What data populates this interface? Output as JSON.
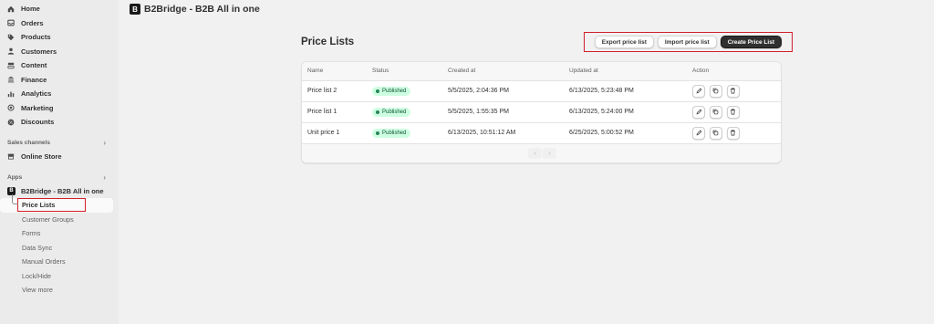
{
  "app": {
    "title": "B2Bridge - B2B All in one",
    "logo_letter": "B"
  },
  "sidebar": {
    "nav": [
      {
        "label": "Home",
        "icon": "home-icon"
      },
      {
        "label": "Orders",
        "icon": "orders-icon"
      },
      {
        "label": "Products",
        "icon": "tag-icon"
      },
      {
        "label": "Customers",
        "icon": "person-icon"
      },
      {
        "label": "Content",
        "icon": "content-icon"
      },
      {
        "label": "Finance",
        "icon": "bank-icon"
      },
      {
        "label": "Analytics",
        "icon": "bar-chart-icon"
      },
      {
        "label": "Marketing",
        "icon": "target-icon"
      },
      {
        "label": "Discounts",
        "icon": "discount-icon"
      }
    ],
    "sales_channels_label": "Sales channels",
    "online_store_label": "Online Store",
    "apps_label": "Apps",
    "app_name": "B2Bridge - B2B All in one",
    "app_subitems": [
      "Price Lists",
      "Customer Groups",
      "Forms",
      "Data Sync",
      "Manual Orders",
      "Lock/Hide",
      "View more"
    ]
  },
  "main": {
    "page_title": "Price Lists",
    "buttons": {
      "export": "Export price list",
      "import": "Import price list",
      "create": "Create Price List"
    },
    "table": {
      "headers": [
        "Name",
        "Status",
        "Created at",
        "Updated at",
        "Action"
      ],
      "rows": [
        {
          "name": "Price list 2",
          "status": "Published",
          "created": "5/5/2025, 2:04:36 PM",
          "updated": "6/13/2025, 5:23:48 PM"
        },
        {
          "name": "Price list 1",
          "status": "Published",
          "created": "5/5/2025, 1:55:35 PM",
          "updated": "6/13/2025, 5:24:00 PM"
        },
        {
          "name": "Unit price 1",
          "status": "Published",
          "created": "6/13/2025, 10:51:12 AM",
          "updated": "6/25/2025, 5:00:52 PM"
        }
      ]
    },
    "pager": {
      "prev": "‹",
      "next": "›"
    }
  },
  "colors": {
    "highlight": "#d21f2b",
    "published_bg": "#cdfee1",
    "primary_button": "#303030"
  }
}
